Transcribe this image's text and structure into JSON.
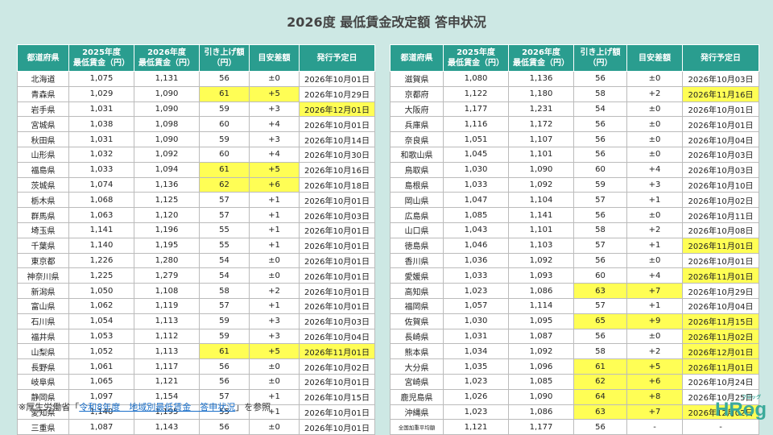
{
  "title": "2026度 最低賃金改定額 答申状況",
  "headers": [
    "都道府県",
    "2025年度\n最低賃金（円）",
    "2026年度\n最低賃金（円）",
    "引き上げ額\n（円）",
    "目安差額",
    "発行予定日"
  ],
  "left_rows": [
    [
      "北海道",
      "1,075",
      "1,131",
      "56",
      "±0",
      "2026年10月01日"
    ],
    [
      "青森県",
      "1,029",
      "1,090",
      "61",
      "+5",
      "2026年10月29日"
    ],
    [
      "岩手県",
      "1,031",
      "1,090",
      "59",
      "+3",
      "2026年12月01日"
    ],
    [
      "宮城県",
      "1,038",
      "1,098",
      "60",
      "+4",
      "2026年10月01日"
    ],
    [
      "秋田県",
      "1,031",
      "1,090",
      "59",
      "+3",
      "2026年10月14日"
    ],
    [
      "山形県",
      "1,032",
      "1,092",
      "60",
      "+4",
      "2026年10月30日"
    ],
    [
      "福島県",
      "1,033",
      "1,094",
      "61",
      "+5",
      "2026年10月16日"
    ],
    [
      "茨城県",
      "1,074",
      "1,136",
      "62",
      "+6",
      "2026年10月18日"
    ],
    [
      "栃木県",
      "1,068",
      "1,125",
      "57",
      "+1",
      "2026年10月01日"
    ],
    [
      "群馬県",
      "1,063",
      "1,120",
      "57",
      "+1",
      "2026年10月03日"
    ],
    [
      "埼玉県",
      "1,141",
      "1,196",
      "55",
      "+1",
      "2026年10月01日"
    ],
    [
      "千葉県",
      "1,140",
      "1,195",
      "55",
      "+1",
      "2026年10月01日"
    ],
    [
      "東京都",
      "1,226",
      "1,280",
      "54",
      "±0",
      "2026年10月01日"
    ],
    [
      "神奈川県",
      "1,225",
      "1,279",
      "54",
      "±0",
      "2026年10月01日"
    ],
    [
      "新潟県",
      "1,050",
      "1,108",
      "58",
      "+2",
      "2026年10月01日"
    ],
    [
      "富山県",
      "1,062",
      "1,119",
      "57",
      "+1",
      "2026年10月01日"
    ],
    [
      "石川県",
      "1,054",
      "1,113",
      "59",
      "+3",
      "2026年10月03日"
    ],
    [
      "福井県",
      "1,053",
      "1,112",
      "59",
      "+3",
      "2026年10月04日"
    ],
    [
      "山梨県",
      "1,052",
      "1,113",
      "61",
      "+5",
      "2026年11月01日"
    ],
    [
      "長野県",
      "1,061",
      "1,117",
      "56",
      "±0",
      "2026年10月02日"
    ],
    [
      "岐阜県",
      "1,065",
      "1,121",
      "56",
      "±0",
      "2026年10月01日"
    ],
    [
      "静岡県",
      "1,097",
      "1,154",
      "57",
      "+1",
      "2026年10月15日"
    ],
    [
      "愛知県",
      "1,140",
      "1,195",
      "55",
      "+1",
      "2026年10月01日"
    ],
    [
      "三重県",
      "1,087",
      "1,143",
      "56",
      "±0",
      "2026年10月01日"
    ]
  ],
  "left_highlights": [
    [
      1,
      3
    ],
    [
      1,
      4
    ],
    [
      2,
      5
    ],
    [
      6,
      3
    ],
    [
      6,
      4
    ],
    [
      7,
      3
    ],
    [
      7,
      4
    ],
    [
      18,
      3
    ],
    [
      18,
      4
    ],
    [
      18,
      5
    ]
  ],
  "right_rows": [
    [
      "滋賀県",
      "1,080",
      "1,136",
      "56",
      "±0",
      "2026年10月03日"
    ],
    [
      "京都府",
      "1,122",
      "1,180",
      "58",
      "+2",
      "2026年11月16日"
    ],
    [
      "大阪府",
      "1,177",
      "1,231",
      "54",
      "±0",
      "2026年10月01日"
    ],
    [
      "兵庫県",
      "1,116",
      "1,172",
      "56",
      "±0",
      "2026年10月01日"
    ],
    [
      "奈良県",
      "1,051",
      "1,107",
      "56",
      "±0",
      "2026年10月04日"
    ],
    [
      "和歌山県",
      "1,045",
      "1,101",
      "56",
      "±0",
      "2026年10月03日"
    ],
    [
      "鳥取県",
      "1,030",
      "1,090",
      "60",
      "+4",
      "2026年10月03日"
    ],
    [
      "島根県",
      "1,033",
      "1,092",
      "59",
      "+3",
      "2026年10月10日"
    ],
    [
      "岡山県",
      "1,047",
      "1,104",
      "57",
      "+1",
      "2026年10月02日"
    ],
    [
      "広島県",
      "1,085",
      "1,141",
      "56",
      "±0",
      "2026年10月11日"
    ],
    [
      "山口県",
      "1,043",
      "1,101",
      "58",
      "+2",
      "2026年10月08日"
    ],
    [
      "徳島県",
      "1,046",
      "1,103",
      "57",
      "+1",
      "2026年11月01日"
    ],
    [
      "香川県",
      "1,036",
      "1,092",
      "56",
      "±0",
      "2026年10月01日"
    ],
    [
      "愛媛県",
      "1,033",
      "1,093",
      "60",
      "+4",
      "2026年11月01日"
    ],
    [
      "高知県",
      "1,023",
      "1,086",
      "63",
      "+7",
      "2026年10月29日"
    ],
    [
      "福岡県",
      "1,057",
      "1,114",
      "57",
      "+1",
      "2026年10月04日"
    ],
    [
      "佐賀県",
      "1,030",
      "1,095",
      "65",
      "+9",
      "2026年11月15日"
    ],
    [
      "長崎県",
      "1,031",
      "1,087",
      "56",
      "±0",
      "2026年11月02日"
    ],
    [
      "熊本県",
      "1,034",
      "1,092",
      "58",
      "+2",
      "2026年12月01日"
    ],
    [
      "大分県",
      "1,035",
      "1,096",
      "61",
      "+5",
      "2026年11月01日"
    ],
    [
      "宮崎県",
      "1,023",
      "1,085",
      "62",
      "+6",
      "2026年10月24日"
    ],
    [
      "鹿児島県",
      "1,026",
      "1,090",
      "64",
      "+8",
      "2026年10月25日"
    ],
    [
      "沖縄県",
      "1,023",
      "1,086",
      "63",
      "+7",
      "2026年12月02日"
    ],
    [
      "全国加重平均額",
      "1,121",
      "1,177",
      "56",
      "-",
      "-"
    ]
  ],
  "right_highlights": [
    [
      1,
      5
    ],
    [
      11,
      5
    ],
    [
      13,
      5
    ],
    [
      14,
      3
    ],
    [
      14,
      4
    ],
    [
      16,
      3
    ],
    [
      16,
      4
    ],
    [
      16,
      5
    ],
    [
      17,
      5
    ],
    [
      18,
      5
    ],
    [
      19,
      3
    ],
    [
      19,
      4
    ],
    [
      19,
      5
    ],
    [
      20,
      3
    ],
    [
      20,
      4
    ],
    [
      21,
      3
    ],
    [
      21,
      4
    ],
    [
      22,
      3
    ],
    [
      22,
      4
    ],
    [
      22,
      5
    ]
  ],
  "highlight_color": "#fffe55",
  "header_color": "#2a9d8f",
  "footnote": {
    "prefix": "※厚生労働省「",
    "link": "令和8年度　地域別最低賃金　答申状況",
    "suffix": "」を参照"
  },
  "logo": {
    "text": "HRog",
    "sub": "フロッグ"
  }
}
